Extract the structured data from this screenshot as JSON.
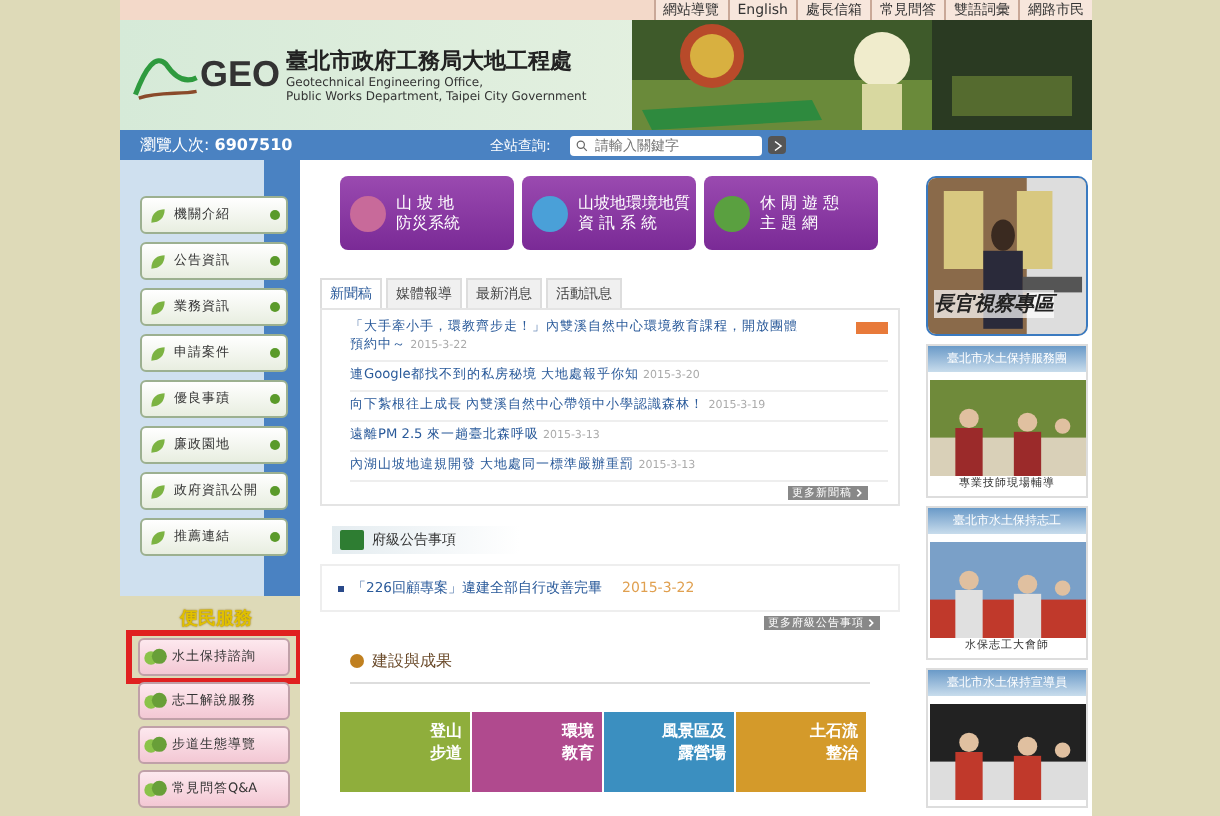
{
  "top_links": [
    "網站導覽",
    "English",
    "處長信箱",
    "常見問答",
    "雙語詞彙",
    "網路市民"
  ],
  "header": {
    "logo": "GEO",
    "title": "臺北市政府工務局大地工程處",
    "subtitle_1": "Geotechnical Engineering Office,",
    "subtitle_2": "Public Works Department, Taipei City Government"
  },
  "info_bar": {
    "visitors_label": "瀏覽人次:",
    "visitors": "6907510",
    "search_label": "全站查詢:",
    "search_placeholder": "請輸入關鍵字"
  },
  "sidebar": {
    "items": [
      "機關介紹",
      "公告資訊",
      "業務資訊",
      "申請案件",
      "優良事蹟",
      "廉政園地",
      "政府資訊公開",
      "推薦連結"
    ],
    "service_title": "便民服務",
    "services": [
      {
        "label": "水土保持諮詢",
        "highlighted": true
      },
      {
        "label": "志工解說服務",
        "highlighted": false
      },
      {
        "label": "步道生態導覽",
        "highlighted": false
      },
      {
        "label": "常見問答Q&A",
        "highlighted": false
      }
    ]
  },
  "systems": [
    {
      "line_1": "山 坡 地",
      "line_2": "防災系統"
    },
    {
      "line_1": "山坡地環境地質",
      "line_2": "資 訊 系 統"
    },
    {
      "line_1": "休 閒 遊 憩",
      "line_2": "主 題 網"
    }
  ],
  "news": {
    "tabs": [
      {
        "label": "新聞稿",
        "selected": true
      },
      {
        "label": "媒體報導",
        "selected": false
      },
      {
        "label": "最新消息",
        "selected": false
      },
      {
        "label": "活動訊息",
        "selected": false
      }
    ],
    "items": [
      {
        "title": "「大手牽小手，環教齊步走！」內雙溪自然中心環境教育課程，開放團體預約中～",
        "date": "2015-3-22",
        "is_new": true
      },
      {
        "title": "連Google都找不到的私房秘境 大地處報乎你知",
        "date": "2015-3-20",
        "is_new": false
      },
      {
        "title": "向下紮根往上成長 內雙溪自然中心帶領中小學認識森林！",
        "date": "2015-3-19",
        "is_new": false
      },
      {
        "title": "遠離PM 2.5 來一趟臺北森呼吸",
        "date": "2015-3-13",
        "is_new": false
      },
      {
        "title": "內湖山坡地違規開發 大地處同一標準嚴辦重罰",
        "date": "2015-3-13",
        "is_new": false
      }
    ],
    "more": "更多新聞稿"
  },
  "notices": {
    "title": "府級公告事項",
    "items": [
      {
        "title": "「226回顧專案」違建全部自行改善完畢",
        "date": "2015-3-22"
      }
    ],
    "more": "更多府級公告事項"
  },
  "achievements": {
    "title": "建設與成果",
    "tiles": [
      {
        "line_1": "登山",
        "line_2": "步道"
      },
      {
        "line_1": "環境",
        "line_2": "教育"
      },
      {
        "line_1": "風景區及",
        "line_2": "露營場"
      },
      {
        "line_1": "土石流",
        "line_2": "整治"
      }
    ]
  },
  "right": {
    "feature": "長官視察專區",
    "panels": [
      {
        "title": "臺北市水土保持服務團",
        "caption": "專業技師現場輔導"
      },
      {
        "title": "臺北市水土保持志工",
        "caption": "水保志工大會師"
      },
      {
        "title": "臺北市水土保持宣導員"
      }
    ]
  }
}
